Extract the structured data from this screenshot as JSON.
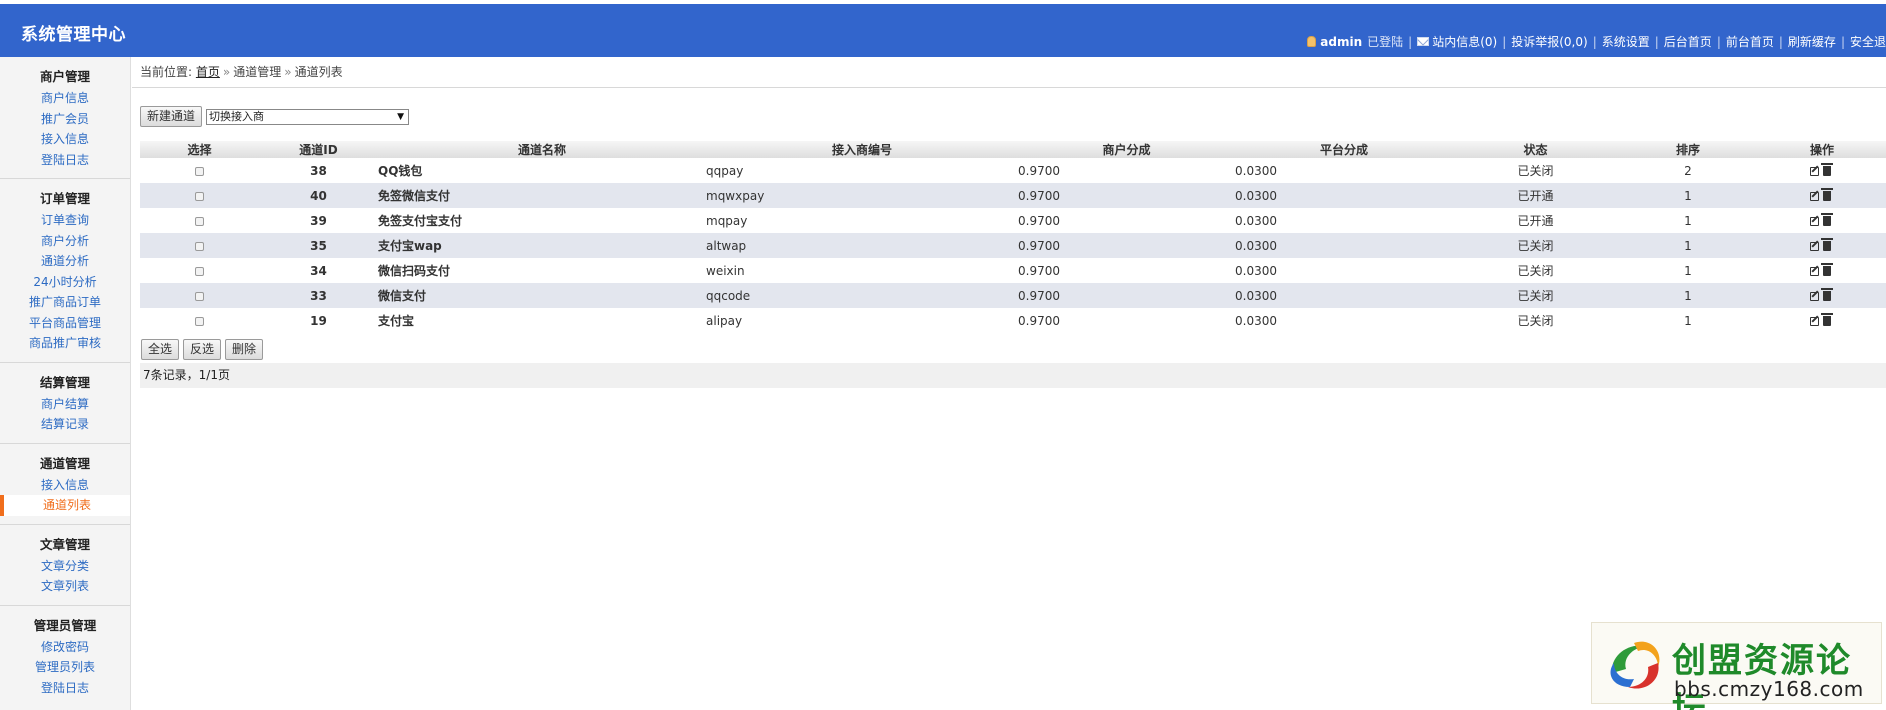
{
  "app": {
    "title": "系统管理中心"
  },
  "topnav": {
    "user": "admin",
    "logged_in": "已登陆",
    "messages": "站内信息(0)",
    "complaints": "投诉举报(0,0)",
    "settings": "系统设置",
    "admin_home": "后台首页",
    "front_home": "前台首页",
    "refresh_cache": "刷新缓存",
    "logout": "安全退"
  },
  "sidebar": {
    "groups": [
      {
        "title": "商户管理",
        "items": [
          "商户信息",
          "推广会员",
          "接入信息",
          "登陆日志"
        ]
      },
      {
        "title": "订单管理",
        "items": [
          "订单查询",
          "商户分析",
          "通道分析",
          "24小时分析",
          "推广商品订单",
          "平台商品管理",
          "商品推广审核"
        ]
      },
      {
        "title": "结算管理",
        "items": [
          "商户结算",
          "结算记录"
        ]
      },
      {
        "title": "通道管理",
        "items": [
          "接入信息",
          "通道列表"
        ]
      },
      {
        "title": "文章管理",
        "items": [
          "文章分类",
          "文章列表"
        ]
      },
      {
        "title": "管理员管理",
        "items": [
          "修改密码",
          "管理员列表",
          "登陆日志"
        ]
      }
    ],
    "active_item": "通道列表"
  },
  "breadcrumb": {
    "label": "当前位置:",
    "home": "首页",
    "section": "通道管理",
    "page": "通道列表"
  },
  "toolbar": {
    "new_channel": "新建通道",
    "provider_select": "切换接入商"
  },
  "table": {
    "headers": [
      "选择",
      "通道ID",
      "通道名称",
      "接入商编号",
      "商户分成",
      "平台分成",
      "状态",
      "排序",
      "操作"
    ],
    "rows": [
      {
        "id": "38",
        "name": "QQ钱包",
        "code": "qqpay",
        "merchant_rate": "0.9700",
        "platform_rate": "0.0300",
        "status": "已关闭",
        "status_on": false,
        "sort": "2"
      },
      {
        "id": "40",
        "name": "免签微信支付",
        "code": "mqwxpay",
        "merchant_rate": "0.9700",
        "platform_rate": "0.0300",
        "status": "已开通",
        "status_on": true,
        "sort": "1"
      },
      {
        "id": "39",
        "name": "免签支付宝支付",
        "code": "mqpay",
        "merchant_rate": "0.9700",
        "platform_rate": "0.0300",
        "status": "已开通",
        "status_on": true,
        "sort": "1"
      },
      {
        "id": "35",
        "name": "支付宝wap",
        "code": "altwap",
        "merchant_rate": "0.9700",
        "platform_rate": "0.0300",
        "status": "已关闭",
        "status_on": false,
        "sort": "1"
      },
      {
        "id": "34",
        "name": "微信扫码支付",
        "code": "weixin",
        "merchant_rate": "0.9700",
        "platform_rate": "0.0300",
        "status": "已关闭",
        "status_on": false,
        "sort": "1"
      },
      {
        "id": "33",
        "name": "微信支付",
        "code": "qqcode",
        "merchant_rate": "0.9700",
        "platform_rate": "0.0300",
        "status": "已关闭",
        "status_on": false,
        "sort": "1"
      },
      {
        "id": "19",
        "name": "支付宝",
        "code": "alipay",
        "merchant_rate": "0.9700",
        "platform_rate": "0.0300",
        "status": "已关闭",
        "status_on": false,
        "sort": "1"
      }
    ]
  },
  "actions": {
    "select_all": "全选",
    "invert": "反选",
    "delete": "删除"
  },
  "pager": {
    "summary": "7条记录，1/1页"
  },
  "watermark": {
    "name": "创盟资源论坛",
    "url": "bbs.cmzy168.com"
  },
  "colors": {
    "header": "#3265cc",
    "status_off": "#e01616",
    "status_on": "#14a514",
    "active_nav": "#f06e1c"
  },
  "icons": {
    "user": "user-icon",
    "mail": "mail-icon",
    "edit": "edit-icon",
    "delete": "trash-icon"
  }
}
